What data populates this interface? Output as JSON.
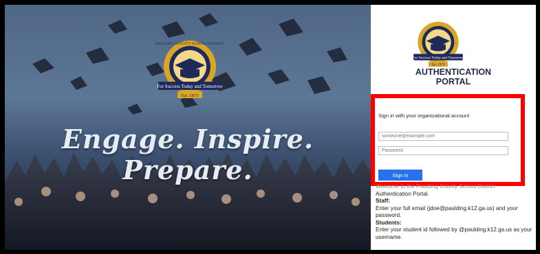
{
  "hero": {
    "tagline": "Engage. Inspire. Prepare.",
    "logo": {
      "arc_top": "PAULDING COUNTY SCHOOL DISTRICT",
      "ribbon": "For Success Today and Tomorrow",
      "established": "Est. 1873"
    }
  },
  "panel": {
    "title_line1": "AUTHENTICATION",
    "title_line2": "PORTAL",
    "signin": {
      "heading": "Sign in with your organizational account",
      "email_placeholder": "someone@example.com",
      "password_placeholder": "Password",
      "button_label": "Sign in"
    },
    "info": {
      "line1_partial": "Welcome to the Paulding County School District",
      "line2": "Authentication Portal.",
      "staff_heading": "Staff:",
      "staff_text": "Enter your full email (jdoe@paulding.k12.ga.us) and your password.",
      "students_heading": "Students:",
      "students_text": "Enter your student id followed by @paulding.k12.ga.us as your username."
    }
  },
  "colors": {
    "accent_red": "#ff0000",
    "button_blue": "#2672ec",
    "logo_gold": "#d9a627",
    "logo_navy": "#1f2a5c"
  }
}
